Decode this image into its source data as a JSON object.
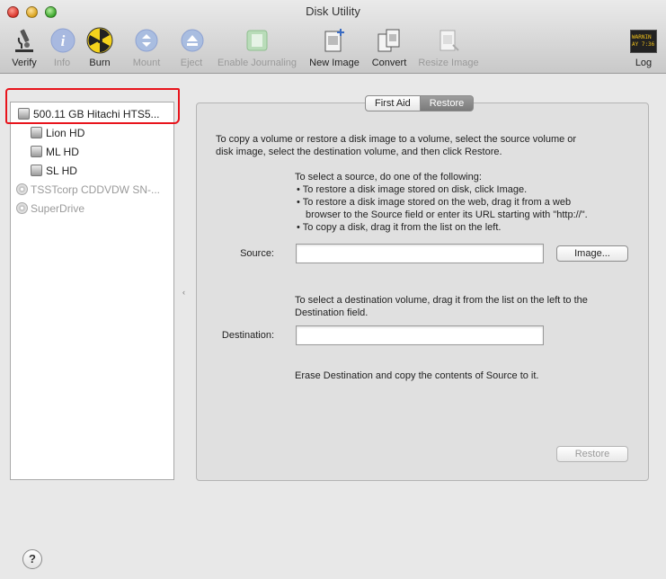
{
  "window": {
    "title": "Disk Utility"
  },
  "toolbar": {
    "verify": "Verify",
    "info": "Info",
    "burn": "Burn",
    "mount": "Mount",
    "eject": "Eject",
    "enable_journaling": "Enable Journaling",
    "new_image": "New Image",
    "convert": "Convert",
    "resize_image": "Resize Image",
    "log": "Log",
    "log_icon_text": [
      "WARNIN",
      "AY 7:36"
    ]
  },
  "sidebar": {
    "items": [
      {
        "label": "500.11 GB Hitachi HTS5...",
        "icon": "hard-disk-icon",
        "enabled": true
      },
      {
        "label": "Lion HD",
        "icon": "volume-icon",
        "enabled": true
      },
      {
        "label": "ML HD",
        "icon": "volume-icon",
        "enabled": true
      },
      {
        "label": "SL HD",
        "icon": "volume-icon",
        "enabled": true
      },
      {
        "label": "TSSTcorp CDDVDW SN-...",
        "icon": "optical-drive-icon",
        "enabled": false
      },
      {
        "label": "SuperDrive",
        "icon": "optical-drive-icon",
        "enabled": false
      }
    ],
    "highlight_color": "#e8141c"
  },
  "tabs": {
    "first_aid": "First Aid",
    "restore": "Restore",
    "selected": "Restore"
  },
  "restore": {
    "intro_line1": "To copy a volume or restore a disk image to a volume, select the source volume or",
    "intro_line2": "disk image, select the destination volume, and then click Restore.",
    "source_heading": "To select a source, do one of the following:",
    "bullet1": "To restore a disk image stored on disk, click Image.",
    "bullet2_line1": "To restore a disk image stored on the web, drag it from a web",
    "bullet2_line2": "browser to the Source field or enter its URL starting with \"http://\".",
    "bullet3": "To copy a disk, drag it from the list on the left.",
    "source_label": "Source:",
    "source_value": "",
    "image_button": "Image...",
    "dest_line1": "To select a destination volume, drag it from the list on the left to the",
    "dest_line2": "Destination field.",
    "destination_label": "Destination:",
    "destination_value": "",
    "erase_text": "Erase Destination and copy the contents of Source to it.",
    "restore_button": "Restore"
  },
  "help": {
    "label": "?"
  }
}
